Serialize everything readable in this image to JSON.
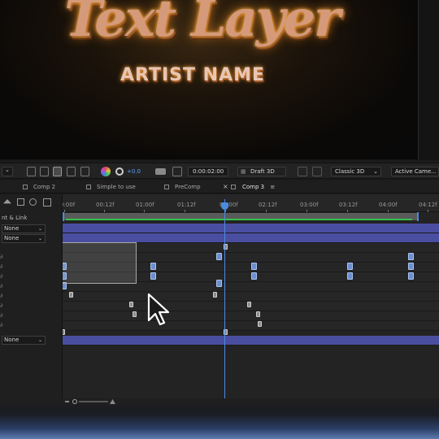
{
  "viewer": {
    "title_text": "Text Layer",
    "artist_text": "ARTIST NAME"
  },
  "toolbar": {
    "zoom_value": "+0.0",
    "timecode": "0:00:02:00",
    "draft_label": "Draft 3D",
    "renderer": "Classic 3D",
    "camera": "Active Came..."
  },
  "tabs": [
    {
      "label": "Comp 2",
      "swatch": "#c9c9c9",
      "active": false
    },
    {
      "label": "Simple to use",
      "swatch": "#c9c9c9",
      "active": false
    },
    {
      "label": "PreComp",
      "swatch": "#c9c9c9",
      "active": false
    },
    {
      "label": "Comp 3",
      "swatch": "#c9c9c9",
      "active": true
    }
  ],
  "tab_close_glyph": "×",
  "tab_menu_glyph": "≡",
  "timeline": {
    "ruler_labels": [
      "0:00f",
      "00:12f",
      "01:00f",
      "01:12f",
      "02:00f",
      "02:12f",
      "03:00f",
      "03:12f",
      "04:00f",
      "04:12f"
    ],
    "playhead_time": "02:00f",
    "left_header": "nt & Link",
    "parent_values": [
      "None",
      "None",
      "None"
    ]
  },
  "colors": {
    "accent_blue": "#4b8be0",
    "layer_bar": "#4a4ea0",
    "work_area_green": "#33c24a"
  },
  "icons": [
    "chevron-down-icon",
    "camera-icon",
    "color-wheel-icon",
    "gear-icon",
    "cursor-arrow-icon",
    "zoom-slider-icon"
  ]
}
